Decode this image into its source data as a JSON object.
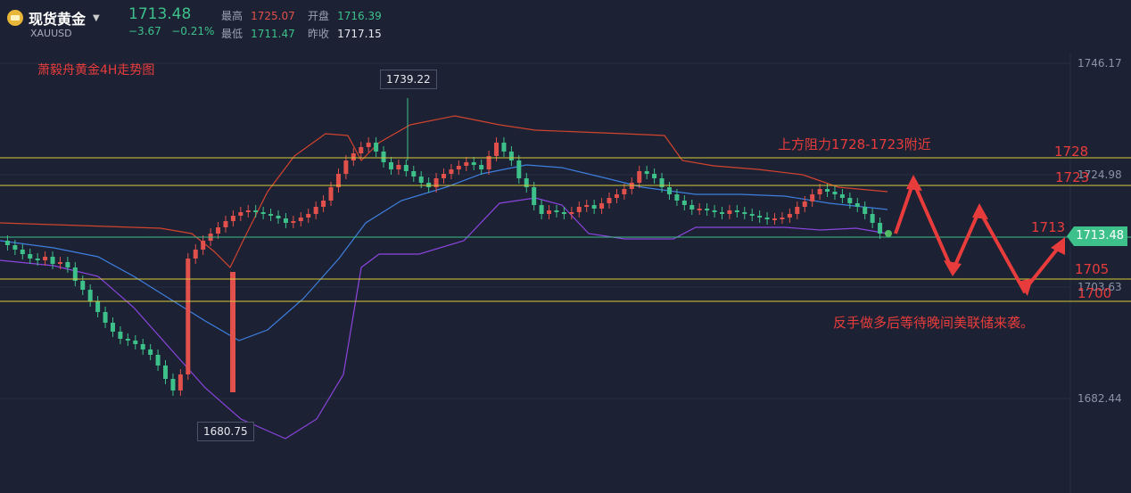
{
  "header": {
    "name": "现货黄金",
    "code": "XAUUSD",
    "price": "1713.48",
    "change": "−3.67",
    "change_pct": "−0.21%",
    "stats": [
      {
        "label": "最高",
        "value": "1725.07",
        "color": "#e2504c"
      },
      {
        "label": "开盘",
        "value": "1716.39",
        "color": "#3dc08a"
      },
      {
        "label": "最低",
        "value": "1711.47",
        "color": "#3dc08a"
      },
      {
        "label": "昨收",
        "value": "1717.15",
        "color": "#e6e8ee"
      }
    ]
  },
  "chart_title": "萧毅舟黄金4H走势图",
  "y_axis": [
    "1746.17",
    "1724.98",
    "1703.63",
    "1682.44"
  ],
  "current_price_tag": "1713.48",
  "callouts": {
    "high": "1739.22",
    "low": "1680.75"
  },
  "annotations": {
    "resistance": "上方阻力1728-1723附近",
    "strategy": "反手做多后等待晚间美联储来袭。"
  },
  "levels": [
    "1728",
    "1723",
    "1713",
    "1705",
    "1700"
  ],
  "colors": {
    "up": "#e2504c",
    "down": "#3dc08a",
    "level_line": "#d9c93a",
    "annotation": "#e83c3c",
    "upper_band": "#d2432f",
    "mid_band": "#3e7fe0",
    "lower_band": "#8c44e0"
  },
  "chart_data": {
    "type": "candlestick",
    "title": "萧毅舟黄金4H走势图",
    "ylim": [
      1680,
      1750
    ],
    "y_ticks": [
      1746.17,
      1724.98,
      1703.63,
      1682.44
    ],
    "marked_high": 1739.22,
    "marked_low": 1680.75,
    "horizontal_levels": [
      1728,
      1723,
      1713,
      1705,
      1700
    ],
    "last_price": 1713.48
  }
}
